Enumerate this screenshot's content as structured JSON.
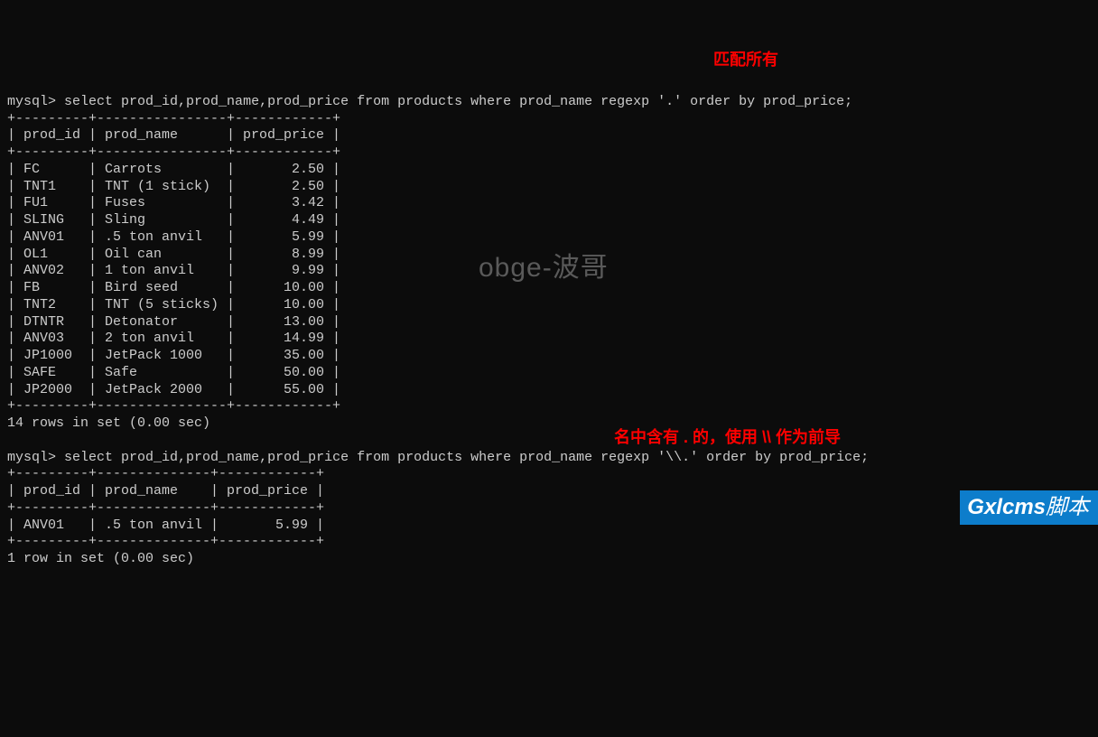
{
  "query1": {
    "prompt": "mysql>",
    "sql": "select prod_id,prod_name,prod_price from products where prod_name regexp '.' order by prod_price;",
    "columns": [
      "prod_id",
      "prod_name",
      "prod_price"
    ],
    "rows": [
      {
        "prod_id": "FC",
        "prod_name": "Carrots",
        "prod_price": "2.50"
      },
      {
        "prod_id": "TNT1",
        "prod_name": "TNT (1 stick)",
        "prod_price": "2.50"
      },
      {
        "prod_id": "FU1",
        "prod_name": "Fuses",
        "prod_price": "3.42"
      },
      {
        "prod_id": "SLING",
        "prod_name": "Sling",
        "prod_price": "4.49"
      },
      {
        "prod_id": "ANV01",
        "prod_name": ".5 ton anvil",
        "prod_price": "5.99"
      },
      {
        "prod_id": "OL1",
        "prod_name": "Oil can",
        "prod_price": "8.99"
      },
      {
        "prod_id": "ANV02",
        "prod_name": "1 ton anvil",
        "prod_price": "9.99"
      },
      {
        "prod_id": "FB",
        "prod_name": "Bird seed",
        "prod_price": "10.00"
      },
      {
        "prod_id": "TNT2",
        "prod_name": "TNT (5 sticks)",
        "prod_price": "10.00"
      },
      {
        "prod_id": "DTNTR",
        "prod_name": "Detonator",
        "prod_price": "13.00"
      },
      {
        "prod_id": "ANV03",
        "prod_name": "2 ton anvil",
        "prod_price": "14.99"
      },
      {
        "prod_id": "JP1000",
        "prod_name": "JetPack 1000",
        "prod_price": "35.00"
      },
      {
        "prod_id": "SAFE",
        "prod_name": "Safe",
        "prod_price": "50.00"
      },
      {
        "prod_id": "JP2000",
        "prod_name": "JetPack 2000",
        "prod_price": "55.00"
      }
    ],
    "summary": "14 rows in set (0.00 sec)",
    "border": "+---------+----------------+------------+",
    "header_line": "| prod_id | prod_name      | prod_price |"
  },
  "query2": {
    "prompt": "mysql>",
    "sql": "select prod_id,prod_name,prod_price from products where prod_name regexp '\\\\.' order by prod_price;",
    "columns": [
      "prod_id",
      "prod_name",
      "prod_price"
    ],
    "rows": [
      {
        "prod_id": "ANV01",
        "prod_name": ".5 ton anvil",
        "prod_price": "5.99"
      }
    ],
    "summary": "1 row in set (0.00 sec)",
    "border": "+---------+--------------+------------+",
    "header_line": "| prod_id | prod_name    | prod_price |"
  },
  "annotations": {
    "a1": "匹配所有",
    "a2": "名中含有 . 的，使用 \\\\ 作为前导"
  },
  "watermark": "obge-波哥",
  "logo": {
    "brand": "Gxlcms",
    "suffix": "脚本"
  }
}
